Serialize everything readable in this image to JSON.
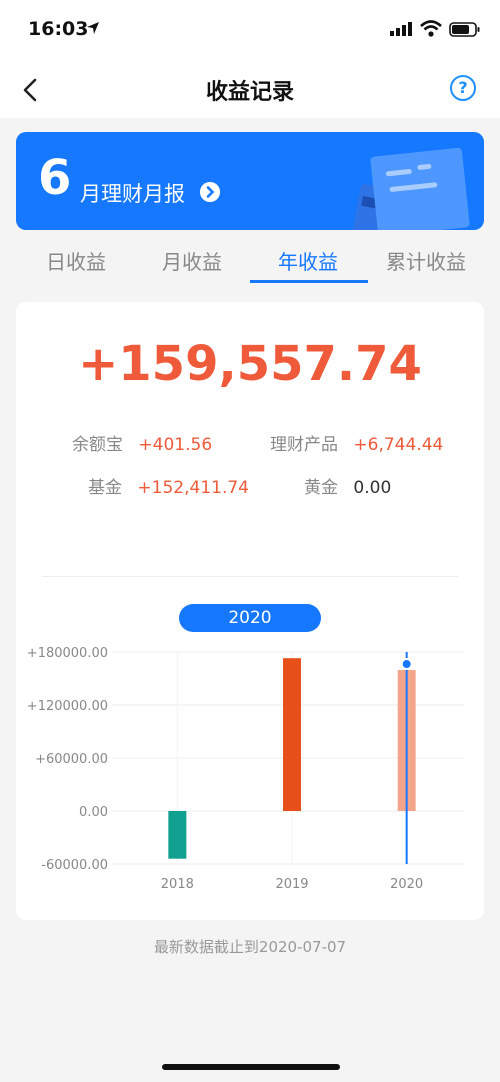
{
  "status": {
    "time": "16:03"
  },
  "nav": {
    "title": "收益记录",
    "help": "?"
  },
  "banner": {
    "num": "6",
    "text": "月理财月报"
  },
  "tabs": [
    "日收益",
    "月收益",
    "年收益",
    "累计收益"
  ],
  "active_tab": 2,
  "summary": {
    "total": "+159,557.74",
    "items": [
      {
        "label": "余额宝",
        "value": "+401.56"
      },
      {
        "label": "理财产品",
        "value": "+6,744.44"
      },
      {
        "label": "基金",
        "value": "+152,411.74"
      },
      {
        "label": "黄金",
        "value": "0.00"
      }
    ]
  },
  "selected_year": "2020",
  "chart_data": {
    "type": "bar",
    "categories": [
      "2018",
      "2019",
      "2020"
    ],
    "values": [
      -54000,
      173000,
      159557.74
    ],
    "ylim": [
      -60000,
      180000
    ],
    "yticks": [
      "+180000.00",
      "+120000.00",
      "+60000.00",
      "0.00",
      "-60000.00"
    ],
    "ytick_values": [
      180000,
      120000,
      60000,
      0,
      -60000
    ],
    "colors": [
      "#10a08f",
      "#e8501a",
      "#f3a58b"
    ],
    "highlight_index": 2,
    "highlight_color": "#1677ff"
  },
  "footer": "最新数据截止到2020-07-07"
}
